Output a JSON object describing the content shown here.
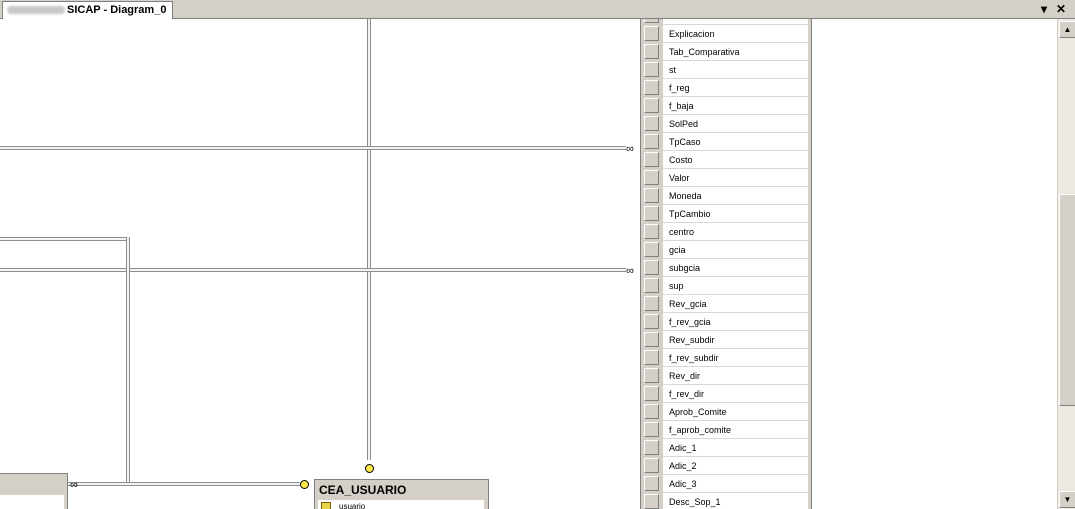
{
  "tab": {
    "title_visible": "SICAP - Diagram_0"
  },
  "window_controls": {
    "dropdown": "▾",
    "close": "✕"
  },
  "scrollbar": {
    "up": "▲",
    "down": "▼"
  },
  "table": {
    "columns": [
      "Explicacion",
      "Tab_Comparativa",
      "st",
      "f_reg",
      "f_baja",
      "SolPed",
      "TpCaso",
      "Costo",
      "Valor",
      "Moneda",
      "TpCambio",
      "centro",
      "gcia",
      "subgcia",
      "sup",
      "Rev_gcia",
      "f_rev_gcia",
      "Rev_subdir",
      "f_rev_subdir",
      "Rev_dir",
      "f_rev_dir",
      "Aprob_Comite",
      "f_aprob_comite",
      "Adic_1",
      "Adic_2",
      "Adic_3",
      "Desc_Sop_1"
    ]
  },
  "cea_usuario": {
    "title": "CEA_USUARIO",
    "first_column": "usuario"
  },
  "relationship_symbols": {
    "many": "∞"
  }
}
